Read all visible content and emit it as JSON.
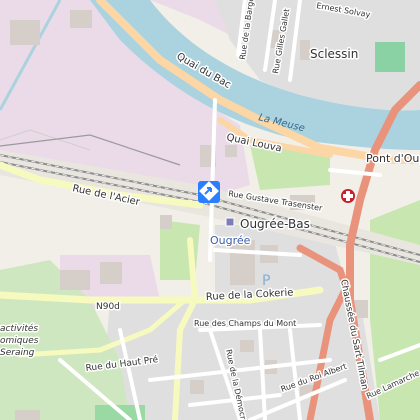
{
  "map": {
    "river_label": "La Meuse",
    "places": {
      "sclessin": "Sclessin",
      "pont_douigree": "Pont d'Ougrée",
      "ougree": "Ougrée",
      "ougree_bas": "Ougrée-Bas",
      "seraing_area": [
        "activités",
        "omiques",
        "Seraing"
      ]
    },
    "roads": {
      "quai_du_bac": "Quai du Bac",
      "quai_louva": "Quai Louva",
      "rue_de_la_barge": "Rue de la Barge",
      "rue_gilles_gallet": "Rue Gilles Gallet",
      "rue_ernest_solvay": "Ernest Solvay",
      "rue_de_lacier": "Rue de l'Acier",
      "rue_gustave_trasenster": "Rue Gustave Trasenster",
      "n90d": "N90d",
      "rue_de_la_cokerie": "Rue de la Cokerie",
      "rue_des_champs_du_mont": "Rue des Champs du Mont",
      "rue_du_haut_pre": "Rue du Haut Pré",
      "rue_de_la_democratie": "Rue de la Démocratie",
      "rue_du_roi_albert": "Rue du Roi Albert",
      "rue_lamarche": "Rue Lamarche",
      "chaussee_du_sart_tilman": "Chaussée du Sart Tilman"
    },
    "poi": {
      "parking": "P",
      "hospital_icon": "hospital-cross-icon",
      "direction_icon": "directions-diamond-icon",
      "station_icon": "train-station-icon"
    },
    "colors": {
      "water": "#aad3df",
      "industrial": "#ebdbe8",
      "residential": "#e0dfdf",
      "park": "#c8e6b0",
      "primary_road": "#fcd6a4",
      "trunk_road": "#e9937c",
      "secondary_road": "#f7fabf",
      "railway": "#9a9a9a",
      "marker": "#2a7fff"
    }
  }
}
